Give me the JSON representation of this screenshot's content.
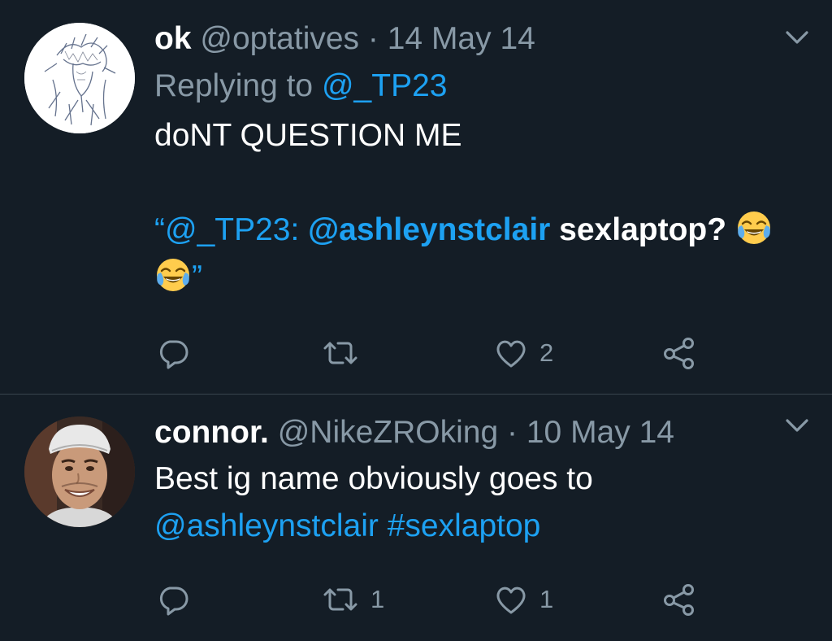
{
  "tweets": [
    {
      "display_name": "ok",
      "handle": "@optatives",
      "separator": "·",
      "date": "14 May 14",
      "replying_prefix": "Replying to",
      "replying_to": "@_TP23",
      "body": {
        "line1": "doNT QUESTION ME",
        "quote_open": "“@_TP23: ",
        "mention": "@ashleynstclair",
        "text_after_mention": " sexlaptop? ",
        "quote_close": "”"
      },
      "avatar_icon": "sketch-drawing-avatar",
      "actions": {
        "reply_count": "",
        "retweet_count": "",
        "like_count": "2"
      }
    },
    {
      "display_name": "connor.",
      "handle": "@NikeZROking",
      "separator": "·",
      "date": "10 May 14",
      "body": {
        "line1": "Best ig name obviously goes to",
        "mention": "@ashleynstclair",
        "hashtag": "#sexlaptop"
      },
      "avatar_icon": "smiling-man-photo-avatar",
      "actions": {
        "reply_count": "",
        "retweet_count": "1",
        "like_count": "1"
      }
    }
  ],
  "colors": {
    "background": "#141d26",
    "text": "#ffffff",
    "secondary": "#8899a6",
    "link": "#1da1f2",
    "divider": "#38444d"
  }
}
